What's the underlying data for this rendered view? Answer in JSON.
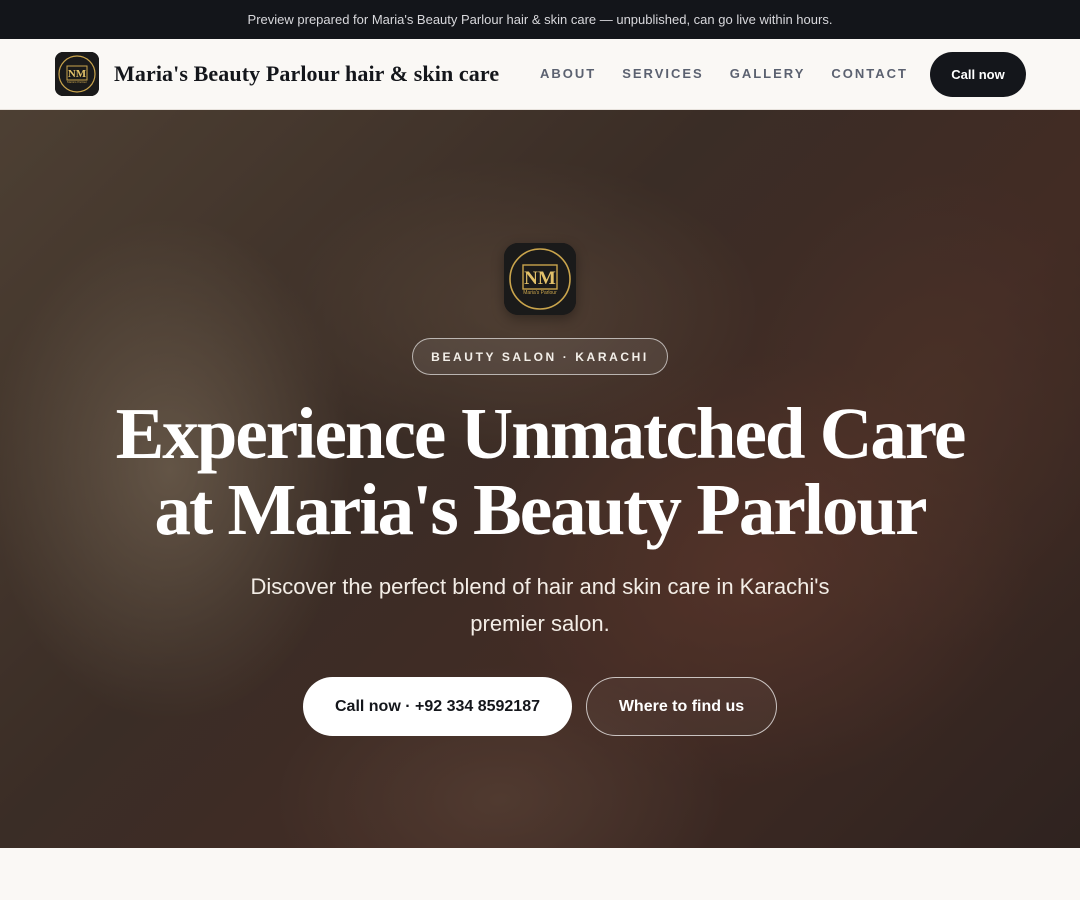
{
  "topbar": {
    "notice": "Preview prepared for Maria's Beauty Parlour hair & skin care — unpublished, can go live within hours."
  },
  "header": {
    "brand_name": "Maria's Beauty Parlour hair & skin care",
    "logo_text": "NM",
    "logo_subtext": "Maria's Parlour",
    "nav": [
      "ABOUT",
      "SERVICES",
      "GALLERY",
      "CONTACT"
    ],
    "call_label": "Call now"
  },
  "hero": {
    "logo_text": "NM",
    "logo_subtext": "Maria's Parlour",
    "tagline": "BEAUTY SALON · KARACHI",
    "headline_line1": "Experience Unmatched Care",
    "headline_line2": "at Maria's Beauty Parlour",
    "subhead_line1": "Discover the perfect blend of hair and skin care in Karachi's",
    "subhead_line2": "premier salon.",
    "primary_button": "Call now · +92 334 8592187",
    "secondary_button": "Where to find us"
  },
  "colors": {
    "dark": "#14161b",
    "gold": "#c9a44c",
    "background": "#faf8f5"
  }
}
